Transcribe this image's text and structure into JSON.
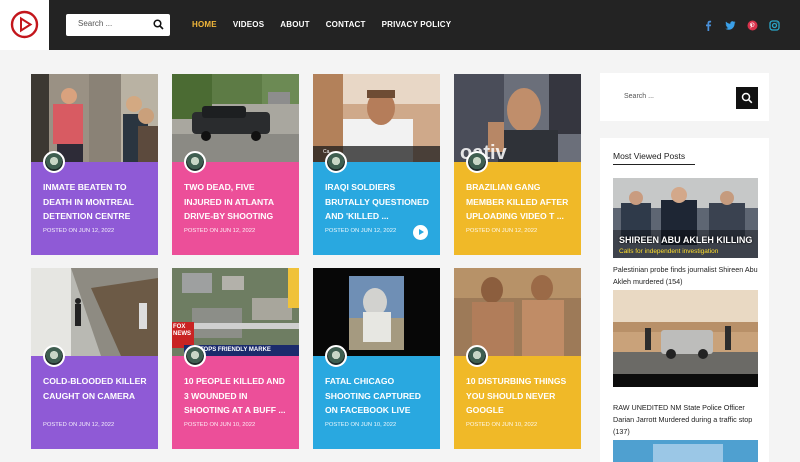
{
  "header": {
    "search_placeholder": "Search ...",
    "nav": [
      "HOME",
      "VIDEOS",
      "ABOUT",
      "CONTACT",
      "PRIVACY POLICY"
    ],
    "active_nav": "HOME",
    "social_icons": [
      "facebook-icon",
      "twitter-icon",
      "pinterest-icon",
      "instagram-icon"
    ]
  },
  "posts": [
    {
      "title": "INMATE BEATEN TO DEATH IN MONTREAL DETENTION CENTRE",
      "date": "POSTED ON JUN 12, 2022",
      "color": "#8f5ad6"
    },
    {
      "title": "TWO DEAD, FIVE INJURED IN ATLANTA DRIVE-BY SHOOTING",
      "date": "POSTED ON JUN 12, 2022",
      "color": "#ec4f99"
    },
    {
      "title": "IRAQI SOLDIERS BRUTALLY QUESTIONED AND 'KILLED ...",
      "date": "POSTED ON JUN 12, 2022",
      "color": "#29a8e0",
      "has_play": true
    },
    {
      "title": "BRAZILIAN GANG MEMBER KILLED AFTER UPLOADING VIDEO T ...",
      "date": "POSTED ON JUN 12, 2022",
      "color": "#f0b928"
    },
    {
      "title": "COLD-BLOODED KILLER CAUGHT ON CAMERA",
      "date": "POSTED ON JUN 12, 2022",
      "color": "#8f5ad6"
    },
    {
      "title": "10 PEOPLE KILLED AND 3 WOUNDED IN SHOOTING AT A BUFF ...",
      "date": "POSTED ON JUN 10, 2022",
      "color": "#ec4f99"
    },
    {
      "title": "FATAL CHICAGO SHOOTING CAPTURED ON FACEBOOK LIVE",
      "date": "POSTED ON JUN 10, 2022",
      "color": "#29a8e0"
    },
    {
      "title": "10 DISTURBING THINGS YOU SHOULD NEVER GOOGLE",
      "date": "POSTED ON JUN 10, 2022",
      "color": "#f0b928"
    }
  ],
  "image_text": {
    "iraqi_caption": "Ca... ...",
    "brazil_overlay": "oativ",
    "fox_logo": "FOX NEWS",
    "tops_sign": "TOPS FRIENDLY MARKE"
  },
  "sidebar": {
    "search_placeholder": "Search ...",
    "most_viewed_title": "Most Viewed Posts",
    "items": [
      {
        "overlay_title": "SHIREEN ABU AKLEH KILLING",
        "overlay_sub": "Calls for independent investigation",
        "caption": "Palestinian probe finds journalist Shireen Abu Akleh murdered (154)"
      },
      {
        "caption": "RAW UNEDITED NM State Police Officer Darian Jarrott Murdered during a traffic stop (137)"
      }
    ]
  }
}
